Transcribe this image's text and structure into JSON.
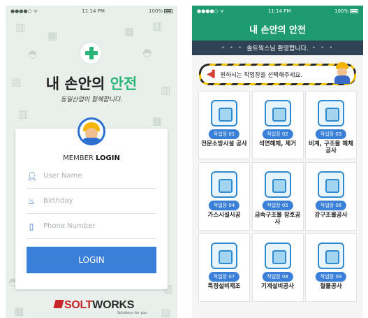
{
  "left_screen": {
    "status": {
      "signal": "●●●●○ ᯤ",
      "time": "11:14 PM",
      "battery": "100%"
    },
    "title_prefix": "내 손안의 ",
    "title_accent": "안전",
    "slogan": "동일산업이 함께합니다.",
    "login_heading_normal": "MEMBER ",
    "login_heading_bold": "LOGIN",
    "fields": {
      "username_placeholder": "User Name",
      "birthday_placeholder": "Birthday",
      "phone_placeholder": "Phone Number"
    },
    "login_button": "LOGIN",
    "brand_red": "SOLT",
    "brand_dark": "WORKS",
    "brand_tagline": "Solutions for you"
  },
  "right_screen": {
    "status": {
      "signal": "●●●●○ ᯤ",
      "time": "11:14 PM",
      "battery": "100%"
    },
    "header_title": "내 손안의 안전",
    "welcome": "솔트웍스님 환영합니다.",
    "welcome_dots": "• • •",
    "banner_text": "원하시는 작업장을 선택해주세요.",
    "sites": [
      {
        "badge": "작업장 01",
        "name": "전문소방시설 공사",
        "icon": "fire-hydrant-icon"
      },
      {
        "badge": "작업장 02",
        "name": "석면해체, 제거",
        "icon": "bulldozer-icon"
      },
      {
        "badge": "작업장 03",
        "name": "비계, 구조물 해체공사",
        "icon": "tower-crane-icon"
      },
      {
        "badge": "작업장 04",
        "name": "가스시설시공",
        "icon": "gas-meter-icon"
      },
      {
        "badge": "작업장 05",
        "name": "금속구조물 창호공사",
        "icon": "excavator-icon"
      },
      {
        "badge": "작업장 06",
        "name": "강구조물공사",
        "icon": "bridge-icon"
      },
      {
        "badge": "작업장 07",
        "name": "특정설비제조",
        "icon": "tanker-truck-icon"
      },
      {
        "badge": "작업장 08",
        "name": "기계설비공사",
        "icon": "pipe-icon"
      },
      {
        "badge": "작업장 09",
        "name": "철물공사",
        "icon": "steel-beam-icon"
      }
    ]
  },
  "colors": {
    "green": "#2bb578",
    "header_green": "#1f9b72",
    "blue": "#3a7fd8",
    "navy": "#2f4354",
    "brand_red": "#c9262c"
  }
}
